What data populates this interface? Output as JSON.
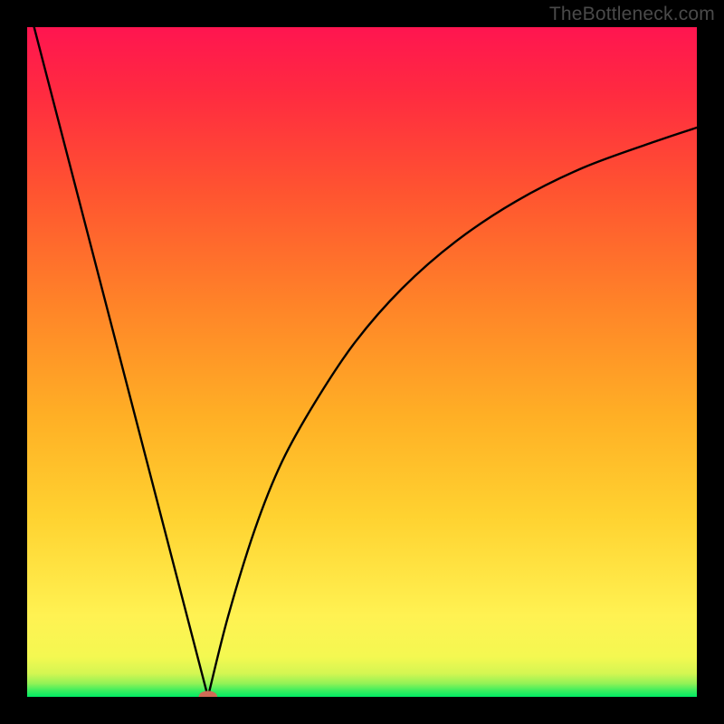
{
  "watermark": "TheBottleneck.com",
  "chart_data": {
    "type": "line",
    "title": "",
    "xlabel": "",
    "ylabel": "",
    "xlim": [
      0,
      100
    ],
    "ylim": [
      0,
      100
    ],
    "background_gradient": {
      "direction": "bottom-to-top",
      "stops": [
        {
          "pos": 0.0,
          "color": "#00eb64"
        },
        {
          "pos": 0.01,
          "color": "#40ee5e"
        },
        {
          "pos": 0.02,
          "color": "#93f256"
        },
        {
          "pos": 0.035,
          "color": "#d4f652"
        },
        {
          "pos": 0.06,
          "color": "#f4f851"
        },
        {
          "pos": 0.12,
          "color": "#fff252"
        },
        {
          "pos": 0.27,
          "color": "#ffd230"
        },
        {
          "pos": 0.42,
          "color": "#ffaf25"
        },
        {
          "pos": 0.58,
          "color": "#ff8528"
        },
        {
          "pos": 0.75,
          "color": "#ff5530"
        },
        {
          "pos": 0.9,
          "color": "#ff2b40"
        },
        {
          "pos": 1.0,
          "color": "#ff1550"
        }
      ]
    },
    "series": [
      {
        "name": "segment-left",
        "kind": "line",
        "x": [
          0,
          27
        ],
        "y": [
          104,
          0
        ]
      },
      {
        "name": "segment-right",
        "kind": "curve",
        "x": [
          27,
          30,
          34,
          38,
          43,
          49,
          56,
          64,
          73,
          83,
          94,
          100
        ],
        "y": [
          0,
          12,
          25,
          35,
          44,
          53,
          61,
          68,
          74,
          79,
          83,
          85
        ]
      }
    ],
    "marker": {
      "name": "bottleneck-point",
      "x": 27,
      "y": 0,
      "rx": 1.4,
      "ry": 0.9,
      "color": "#cf6b56"
    }
  }
}
